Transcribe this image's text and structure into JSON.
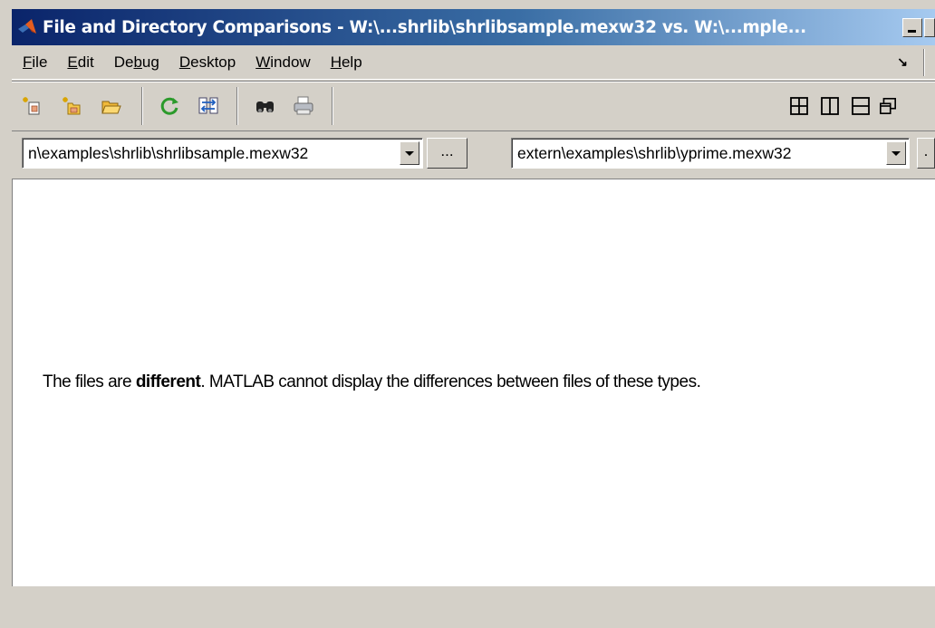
{
  "window": {
    "title": "File and Directory Comparisons - W:\\...shrlib\\shrlibsample.mexw32 vs. W:\\...mple...",
    "icon": "matlab-logo-icon"
  },
  "menu": {
    "items": [
      {
        "label": "File",
        "accel_index": 0
      },
      {
        "label": "Edit",
        "accel_index": 0
      },
      {
        "label": "Debug",
        "accel_index": 2
      },
      {
        "label": "Desktop",
        "accel_index": 0
      },
      {
        "label": "Window",
        "accel_index": 0
      },
      {
        "label": "Help",
        "accel_index": 0
      }
    ],
    "dock_arrow": "↘"
  },
  "toolbar": {
    "buttons": [
      "new-comparison-icon",
      "new-directory-comparison-icon",
      "open-folder-icon",
      "refresh-icon",
      "swap-sides-icon",
      "find-icon",
      "print-icon"
    ],
    "layout_buttons": [
      "tile-grid-icon",
      "tile-columns-icon",
      "tile-rows-icon",
      "float-window-icon"
    ]
  },
  "paths": {
    "left_value": "n\\examples\\shrlib\\shrlibsample.mexw32",
    "right_value": "extern\\examples\\shrlib\\yprime.mexw32",
    "browse_label": "...",
    "browse_label_partial": "."
  },
  "content": {
    "message_prefix": "The files are ",
    "message_bold": "different",
    "message_suffix": ". MATLAB cannot display the differences between files of these types."
  },
  "colors": {
    "titlebar_start": "#0a246a",
    "titlebar_end": "#a6caf0",
    "chrome": "#d4d0c8",
    "content_bg": "#ffffff"
  }
}
